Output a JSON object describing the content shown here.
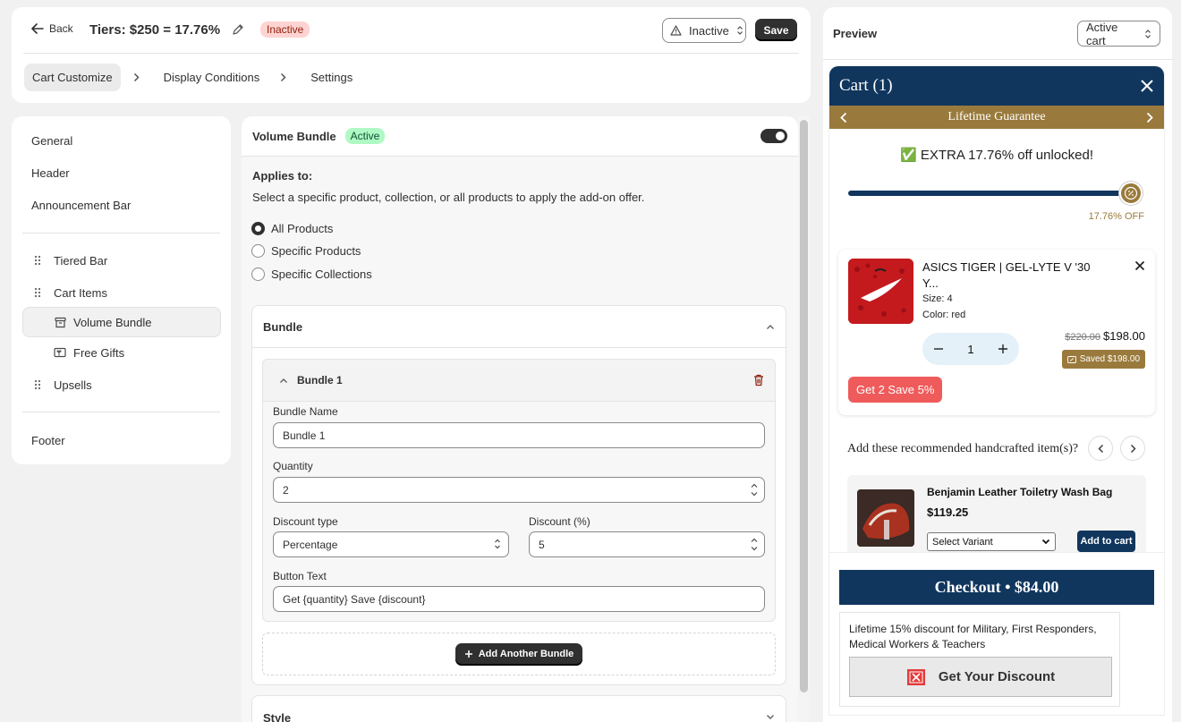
{
  "header": {
    "back_label": "Back",
    "title": "Tiers: $250 = 17.76%",
    "status_badge": "Inactive",
    "status_select": "Inactive",
    "save_label": "Save",
    "steps": [
      "Cart Customize",
      "Display Conditions",
      "Settings"
    ]
  },
  "sidebar": {
    "items": {
      "general": "General",
      "header": "Header",
      "announcement": "Announcement Bar",
      "tiered": "Tiered Bar",
      "cart_items": "Cart Items",
      "volume_bundle": "Volume Bundle",
      "free_gifts": "Free Gifts",
      "upsells": "Upsells",
      "footer": "Footer"
    }
  },
  "main": {
    "title": "Volume Bundle",
    "badge": "Active",
    "applies_title": "Applies to:",
    "applies_desc": "Select a specific product, collection, or all products to apply the add-on offer.",
    "radios": [
      "All Products",
      "Specific Products",
      "Specific Collections"
    ],
    "bundle_section": "Bundle",
    "bundle_item_title": "Bundle 1",
    "fields": {
      "name_label": "Bundle Name",
      "name_value": "Bundle 1",
      "qty_label": "Quantity",
      "qty_value": "2",
      "dtype_label": "Discount type",
      "dtype_value": "Percentage",
      "discount_label": "Discount (%)",
      "discount_value": "5",
      "btn_label": "Button Text",
      "btn_value": "Get {quantity} Save {discount}"
    },
    "add_bundle": "Add Another Bundle",
    "style_section": "Style"
  },
  "preview": {
    "label": "Preview",
    "select": "Active cart",
    "cart_title": "Cart (1)",
    "announcement": "Lifetime Guarantee",
    "unlock_text": "✅ EXTRA 17.76% off unlocked!",
    "progress_label": "17.76% OFF",
    "progress_fraction": 1.0,
    "item": {
      "name": "ASICS TIGER | GEL-LYTE V '30 Y...",
      "size": "Size: 4",
      "color": "Color: red",
      "qty": "1",
      "old_price": "$220.00",
      "price": "$198.00",
      "saved": "Saved $198.00",
      "bundle_btn": "Get 2 Save 5%"
    },
    "rec_title": "Add these recommended handcrafted item(s)?",
    "upsell": {
      "name": "Benjamin Leather Toiletry Wash Bag",
      "price": "$119.25",
      "select": "Select Variant",
      "add": "Add to cart"
    },
    "checkout": "Checkout • $84.00",
    "discount_text": "Lifetime 15% discount for Military, First Responders, Medical Workers & Teachers",
    "discount_btn": "Get Your Discount"
  },
  "colors": {
    "navy": "#10365e",
    "gold": "#9a7a3c",
    "bundle_red": "#ef5b5b",
    "dark_button": "#303030"
  }
}
